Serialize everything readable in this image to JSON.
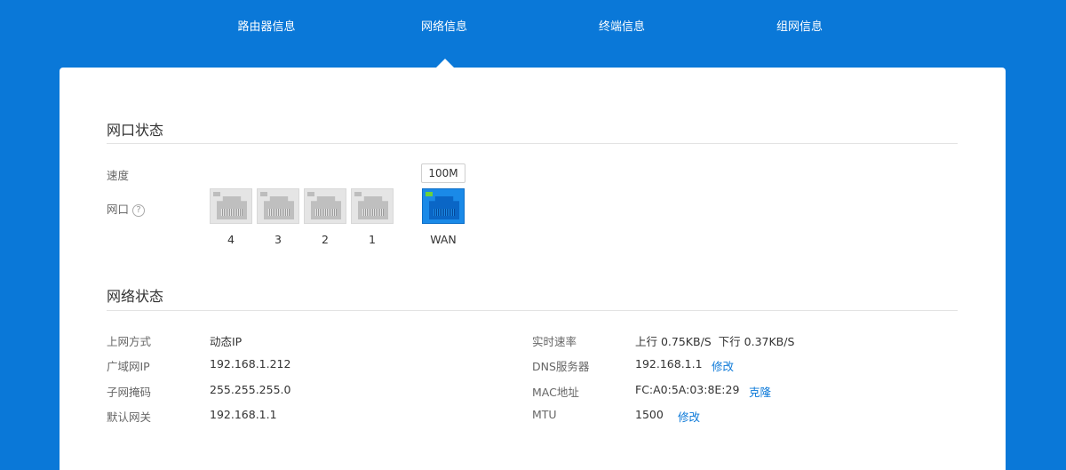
{
  "nav": {
    "tabs": [
      {
        "label": "路由器信息"
      },
      {
        "label": "网络信息"
      },
      {
        "label": "终端信息"
      },
      {
        "label": "组网信息"
      }
    ],
    "active_index": 1
  },
  "port_status": {
    "title": "网口状态",
    "speed_label": "速度",
    "port_label": "网口",
    "help_glyph": "?",
    "wan_speed": "100M",
    "ports": [
      "4",
      "3",
      "2",
      "1"
    ],
    "wan_label": "WAN"
  },
  "network_status": {
    "title": "网络状态",
    "left": [
      {
        "label": "上网方式",
        "value": "动态IP"
      },
      {
        "label": "广域网IP",
        "value": "192.168.1.212"
      },
      {
        "label": "子网掩码",
        "value": "255.255.255.0"
      },
      {
        "label": "默认网关",
        "value": "192.168.1.1"
      }
    ],
    "right": [
      {
        "label": "实时速率",
        "value": "上行 0.75KB/S  下行 0.37KB/S"
      },
      {
        "label": "DNS服务器",
        "value": "192.168.1.1",
        "action": "修改"
      },
      {
        "label": "MAC地址",
        "value": "FC:A0:5A:03:8E:29",
        "action": "克隆"
      },
      {
        "label": "MTU",
        "value": "1500",
        "action": "修改"
      }
    ]
  },
  "colors": {
    "brand": "#0a78d8",
    "wan_active": "#1a8ae8",
    "link_status_led": "#6bd13c"
  }
}
